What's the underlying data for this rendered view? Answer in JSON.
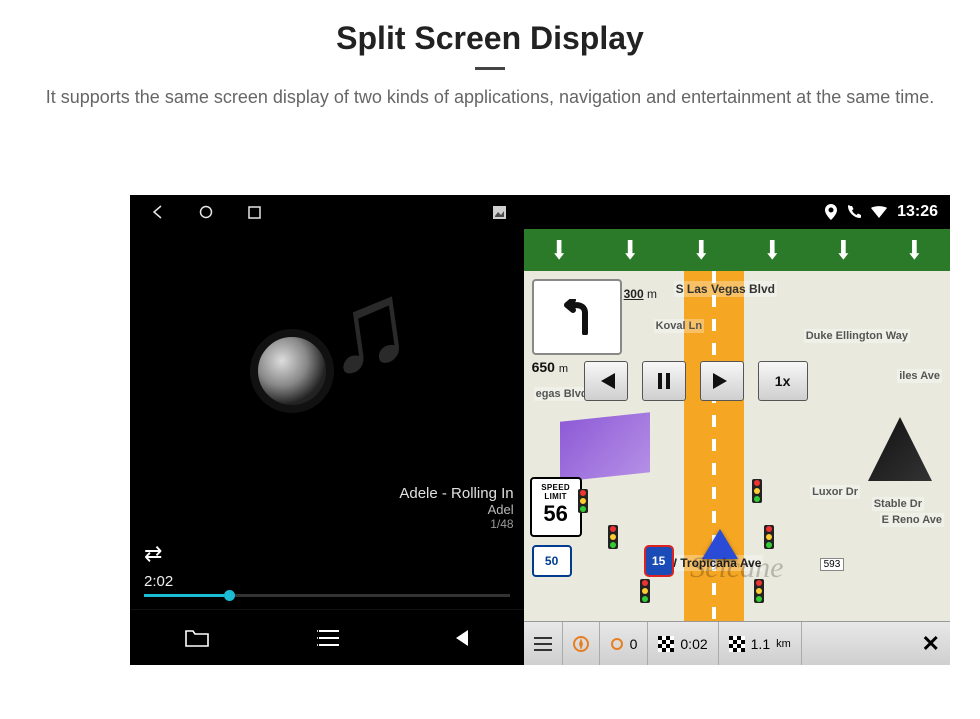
{
  "header": {
    "title": "Split Screen Display",
    "subtitle": "It supports the same screen display of two kinds of applications, navigation and entertainment at the same time."
  },
  "statusbar": {
    "time": "13:26",
    "icons": [
      "location",
      "phone",
      "wifi"
    ]
  },
  "music": {
    "track_title": "Adele - Rolling In",
    "artist": "Adel",
    "index": "1/48",
    "elapsed": "2:02"
  },
  "nav": {
    "lane_count": 6,
    "next_turn_dist": "300",
    "next_turn_unit": "m",
    "approach_dist": "650",
    "approach_unit": "m",
    "speed_limit_label": "SPEED LIMIT",
    "speed_limit": "56",
    "route_shield": "50",
    "interstate": "15",
    "playback_speed": "1x",
    "streets": {
      "s_las_vegas": "S Las Vegas Blvd",
      "koval": "Koval Ln",
      "duke": "Duke Ellington Way",
      "iles": "iles Ave",
      "vegas": "egas Blvd",
      "luxor": "Luxor Dr",
      "stable": "Stable Dr",
      "reno": "E Reno Ave",
      "tropicana": "W Tropicana Ave",
      "tag593": "593"
    },
    "footer": {
      "eta": "0:02",
      "sat": "0",
      "dest_dist": "1.1",
      "dest_unit": "km"
    }
  },
  "watermark": "Seicane"
}
